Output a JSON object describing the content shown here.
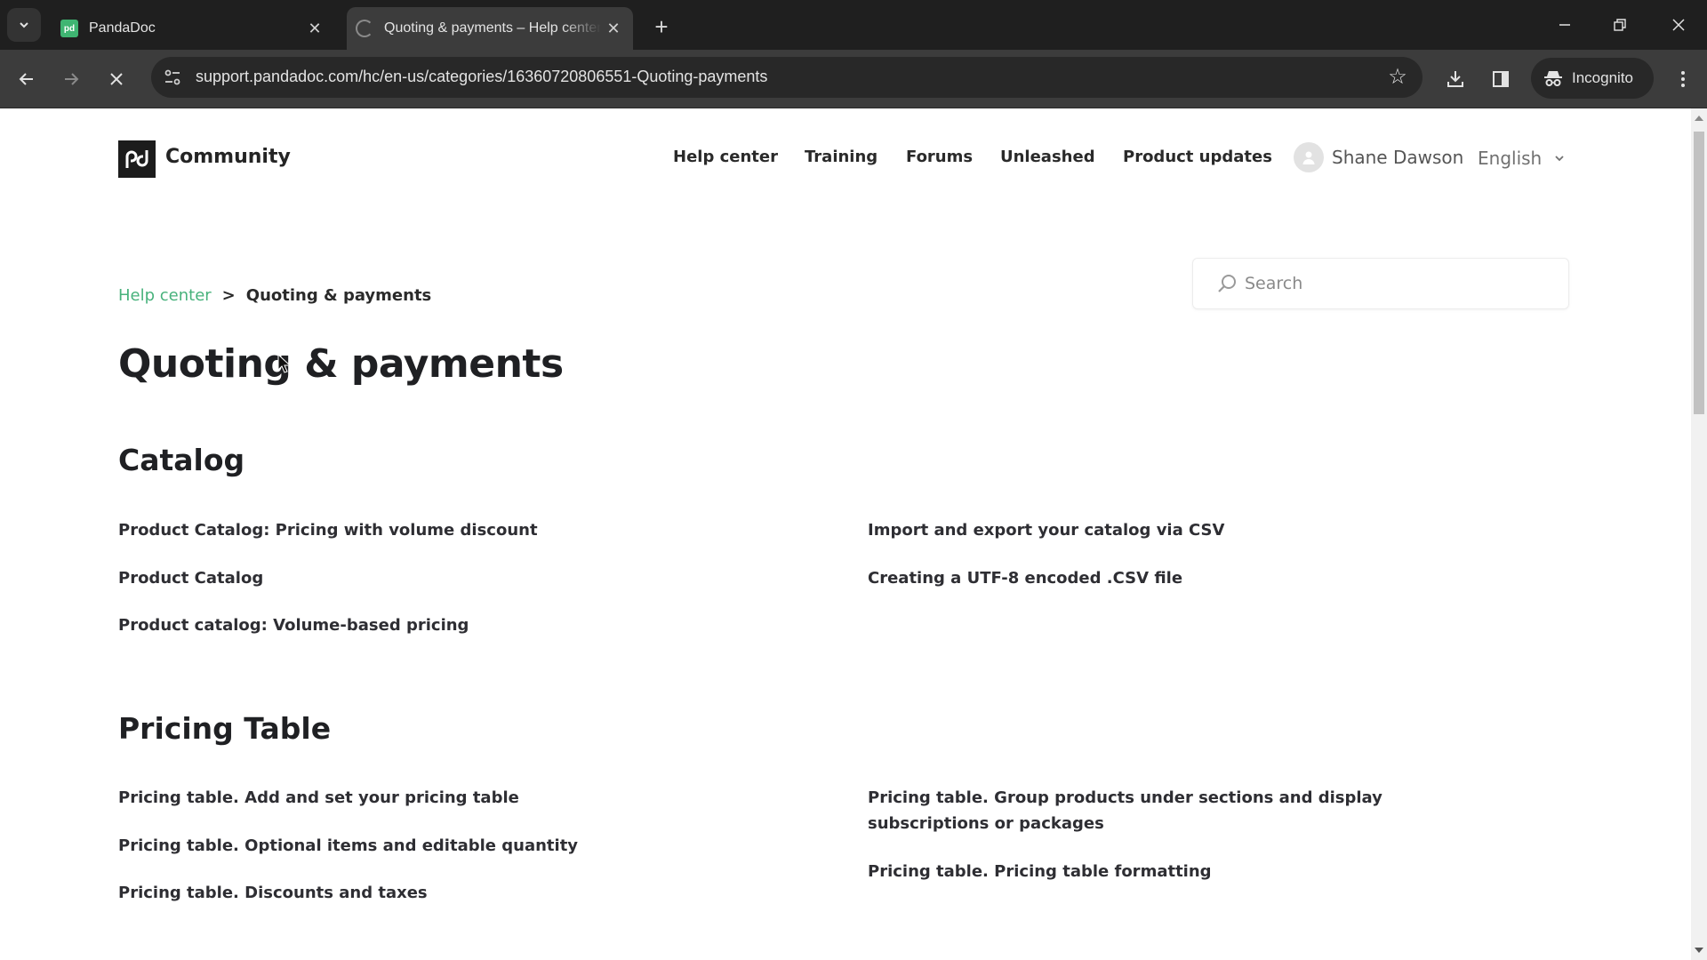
{
  "browser": {
    "tabs": [
      {
        "title": "PandaDoc",
        "favicon": "pandadoc-favicon",
        "active": false
      },
      {
        "title": "Quoting & payments – Help center",
        "favicon": "loading-spinner",
        "active": true
      }
    ],
    "new_tab_label": "+",
    "url": "support.pandadoc.com/hc/en-us/categories/16360720806551-Quoting-payments",
    "profile_label": "Incognito",
    "window_controls": [
      "minimize",
      "restore",
      "close"
    ]
  },
  "site": {
    "brand": "Community",
    "nav": [
      "Help center",
      "Training",
      "Forums",
      "Unleashed",
      "Product updates"
    ],
    "user_name": "Shane Dawson",
    "language": "English",
    "accent_color": "#48b27c"
  },
  "breadcrumb": {
    "items": [
      "Help center",
      "Quoting & payments"
    ],
    "separator": ">"
  },
  "search": {
    "placeholder": "Search",
    "value": ""
  },
  "page_title": "Quoting & payments",
  "sections": [
    {
      "title": "Catalog",
      "articles_left": [
        "Product Catalog: Pricing with volume discount",
        "Product Catalog",
        "Product catalog: Volume-based pricing"
      ],
      "articles_right": [
        "Import and export your catalog via CSV",
        "Creating a UTF-8 encoded .CSV file"
      ]
    },
    {
      "title": "Pricing Table",
      "articles_left": [
        "Pricing table. Add and set your pricing table",
        "Pricing table. Optional items and editable quantity",
        "Pricing table. Discounts and taxes"
      ],
      "articles_right": [
        "Pricing table. Group products under sections and display subscriptions or packages",
        "Pricing table. Pricing table formatting"
      ]
    }
  ]
}
